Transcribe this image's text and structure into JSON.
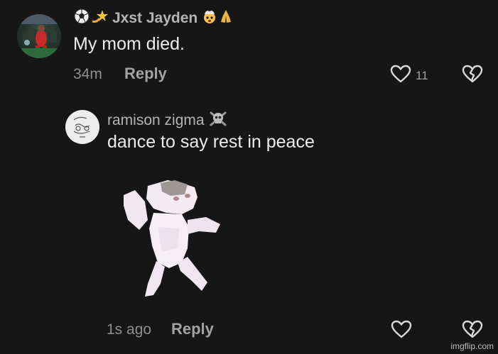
{
  "comment1": {
    "username": "Jxst Jayden",
    "username_emoji_left": [
      "soccer-ball",
      "dizzy"
    ],
    "username_emoji_right": [
      "exploding-head",
      "folded-hands"
    ],
    "text": "My mom died.",
    "time": "34m",
    "reply_label": "Reply",
    "like_count": "11"
  },
  "comment2": {
    "username": "ramison zigma",
    "username_emoji_right": [
      "skull-and-crossbones"
    ],
    "text": "dance to say rest in peace",
    "time": "1s ago",
    "reply_label": "Reply",
    "attachment": "dancing-cat-gif"
  },
  "watermark": "imgflip.com",
  "colors": {
    "background": "#161616",
    "username": "#b4b4b4",
    "comment_text": "#ececec",
    "meta_text": "#8e8e8e",
    "icon": "#d9d9d9"
  }
}
